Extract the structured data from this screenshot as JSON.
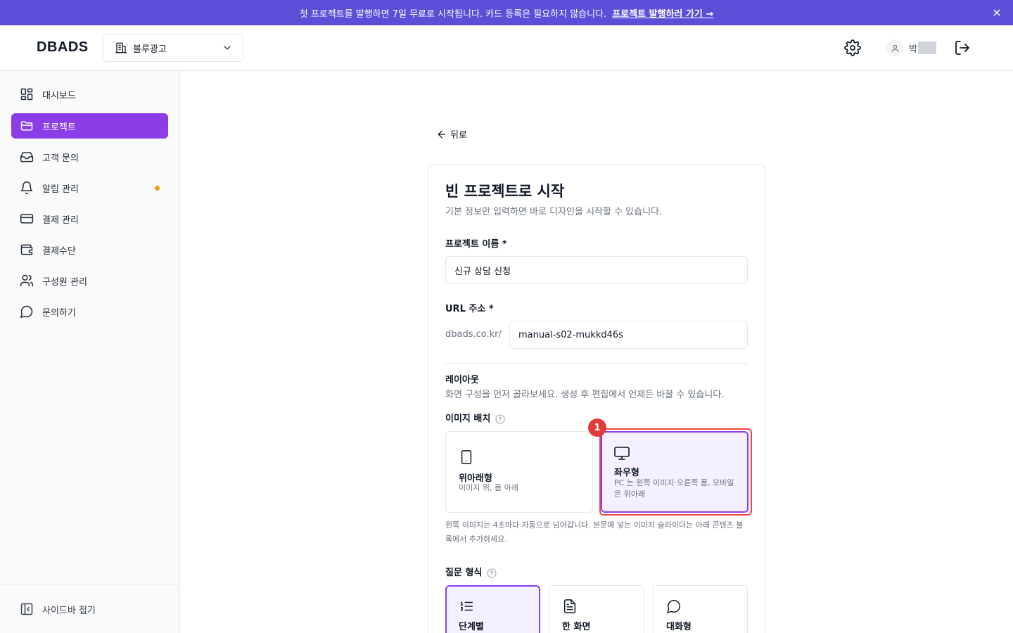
{
  "banner": {
    "message": "첫 프로젝트를 발행하면 7일 무료로 시작됩니다. 카드 등록은 필요하지 않습니다.",
    "link": "프로젝트 발행하러 가기 →",
    "close_icon": "close-icon",
    "bg_color": "#5b4fd8"
  },
  "header": {
    "logo": "DBADS",
    "workspace": "블루광고",
    "user_name": "박",
    "icons": [
      "building-icon",
      "chevron-down-icon",
      "gear-icon",
      "user-icon",
      "logout-icon"
    ]
  },
  "sidebar": {
    "items": [
      {
        "label": "대시보드",
        "icon": "dashboard-icon"
      },
      {
        "label": "프로젝트",
        "icon": "folder-icon",
        "active": true
      },
      {
        "label": "고객 문의",
        "icon": "inbox-icon"
      },
      {
        "label": "알림 관리",
        "icon": "bell-icon",
        "dot": true
      },
      {
        "label": "결제 관리",
        "icon": "credit-card-icon"
      },
      {
        "label": "결제수단",
        "icon": "wallet-icon"
      },
      {
        "label": "구성원 관리",
        "icon": "users-icon"
      },
      {
        "label": "문의하기",
        "icon": "chat-icon"
      }
    ],
    "collapse": "사이드바 접기",
    "active_color": "#8b3ee8"
  },
  "main": {
    "back": "뒤로",
    "title": "빈 프로젝트로 시작",
    "subtitle": "기본 정보만 입력하면 바로 디자인을 시작할 수 있습니다.",
    "name_label": "프로젝트 이름 *",
    "name_value": "신규 상담 신청",
    "url_label": "URL 주소 *",
    "url_prefix": "dbads.co.kr/",
    "url_value": "manual-s02-mukkd46s",
    "layout_title": "레이아웃",
    "layout_desc": "화면 구성을 먼저 골라보세요. 생성 후 편집에서 언제든 바꿀 수 있습니다.",
    "image_label": "이미지 배치",
    "image_options": [
      {
        "title": "위아래형",
        "desc": "이미지 위, 폼 아래",
        "icon": "tablet-icon"
      },
      {
        "title": "좌우형",
        "desc": "PC 는 왼쪽 이미지·오른쪽 폼, 모바일은 위아래",
        "icon": "monitor-icon",
        "selected": true
      }
    ],
    "step_badge": "1",
    "note": "왼쪽 이미지는 4초마다 자동으로 넘어갑니다. 본문에 넣는 이미지 슬라이더는 아래 콘텐츠 블록에서 추가하세요.",
    "question_label": "질문 형식",
    "question_options": [
      {
        "title": "단계별",
        "icon": "list-ordered-icon",
        "selected": true
      },
      {
        "title": "한 화면",
        "icon": "document-icon"
      },
      {
        "title": "대화형",
        "icon": "chat-bubble-icon"
      }
    ]
  }
}
